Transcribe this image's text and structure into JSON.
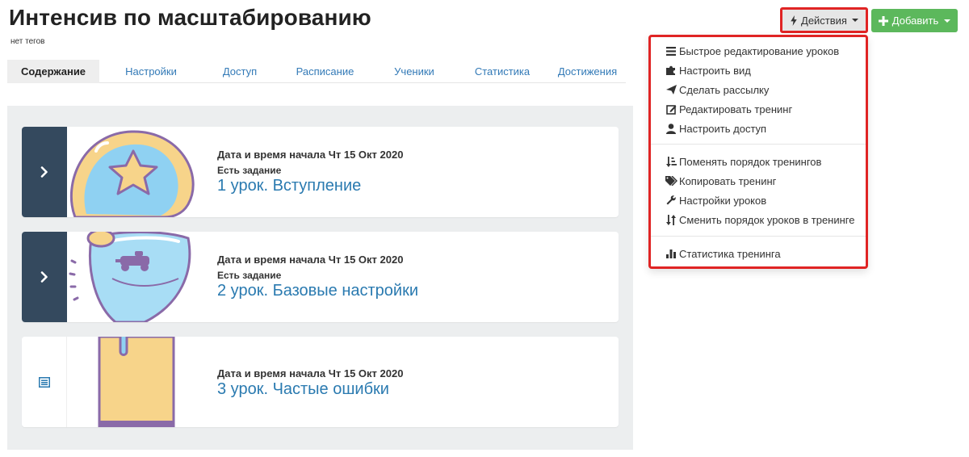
{
  "header": {
    "title": "Интенсив по масштабированию",
    "tags": "нет тегов"
  },
  "toolbar": {
    "actions_label": "Действия",
    "add_label": "Добавить"
  },
  "tabs": [
    {
      "label": "Содержание",
      "active": true
    },
    {
      "label": "Настройки"
    },
    {
      "label": "Доступ"
    },
    {
      "label": "Расписание"
    },
    {
      "label": "Ученики"
    },
    {
      "label": "Статистика"
    },
    {
      "label": "Достижения"
    }
  ],
  "lessons": [
    {
      "date": "Дата и время начала Чт 15 Окт 2020",
      "task": "Есть задание",
      "name": "1 урок. Вступление",
      "icon": "chevron-right-icon"
    },
    {
      "date": "Дата и время начала Чт 15 Окт 2020",
      "task": "Есть задание",
      "name": "2 урок. Базовые настройки",
      "icon": "chevron-right-icon"
    },
    {
      "date": "Дата и время начала Чт 15 Окт 2020",
      "name": "3 урок. Частые ошибки",
      "icon": "list-icon"
    }
  ],
  "actions_menu": {
    "groups": [
      [
        {
          "label": "Быстрое редактирование уроков",
          "icon": "bars-icon"
        },
        {
          "label": "Настроить вид",
          "icon": "puzzle-icon"
        },
        {
          "label": "Сделать рассылку",
          "icon": "send-icon"
        },
        {
          "label": "Редактировать тренинг",
          "icon": "edit-icon"
        },
        {
          "label": "Настроить доступ",
          "icon": "user-icon"
        }
      ],
      [
        {
          "label": "Поменять порядок тренингов",
          "icon": "sort-order-icon"
        },
        {
          "label": "Копировать тренинг",
          "icon": "tags-icon"
        },
        {
          "label": "Настройки уроков",
          "icon": "wrench-icon"
        },
        {
          "label": "Сменить порядок уроков в тренинге",
          "icon": "sort-arrows-icon"
        }
      ],
      [
        {
          "label": "Статистика тренинга",
          "icon": "bar-chart-icon"
        }
      ]
    ]
  },
  "colors": {
    "accent_highlight": "#e02424",
    "link": "#2a7ab0",
    "add_button": "#5cb85c",
    "toggle_dark": "#34495e"
  }
}
